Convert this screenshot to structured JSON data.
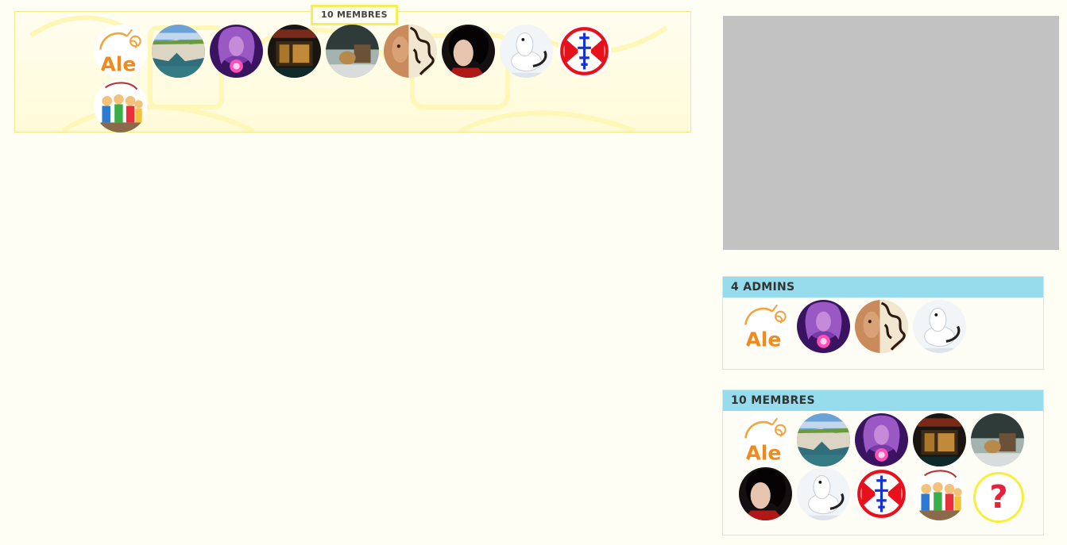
{
  "members_panel": {
    "title": "10 MEMBRES",
    "avatars": [
      "ale-logo",
      "cliffs",
      "purple-orb",
      "dark-storefront",
      "guitar-scene",
      "tribal-face",
      "michael-portrait",
      "white-weasel",
      "kyokushin-emblem",
      "comic-group"
    ]
  },
  "sidebar": {
    "admins_widget": {
      "title": "4 ADMINS",
      "avatars": [
        "ale-logo",
        "purple-orb",
        "tribal-face",
        "white-weasel"
      ]
    },
    "members_widget": {
      "title": "10 MEMBRES",
      "avatars": [
        "ale-logo",
        "cliffs",
        "purple-orb",
        "dark-storefront",
        "guitar-scene",
        "michael-portrait",
        "white-weasel",
        "kyokushin-emblem",
        "comic-group",
        "question-mark"
      ],
      "more_glyph": "?"
    }
  },
  "colors": {
    "widget_header": "#96dcec",
    "highlight_border": "#f7ef5a",
    "ad_placeholder": "#c2c2c2",
    "question_mark": "#e8213a"
  }
}
